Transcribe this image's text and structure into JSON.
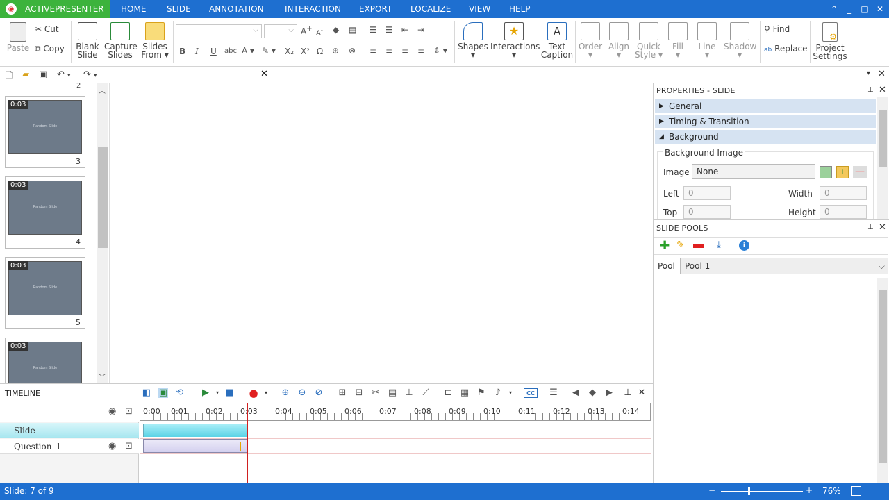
{
  "app": {
    "name": "ACTIVEPRESENTER"
  },
  "menu_tabs": [
    "HOME",
    "SLIDE",
    "ANNOTATION",
    "INTERACTION",
    "EXPORT",
    "LOCALIZE",
    "VIEW",
    "HELP"
  ],
  "ribbon": {
    "paste": "Paste",
    "cut": "Cut",
    "copy": "Copy",
    "blank_slide": [
      "Blank",
      "Slide"
    ],
    "capture_slides": [
      "Capture",
      "Slides"
    ],
    "slides_from": [
      "Slides",
      "From"
    ],
    "shapes": "Shapes",
    "interactions": "Interactions",
    "text_caption": [
      "Text",
      "Caption"
    ],
    "order": "Order",
    "align": "Align",
    "quick_style": [
      "Quick",
      "Style"
    ],
    "fill": "Fill",
    "line": "Line",
    "shadow": "Shadow",
    "find": "Find",
    "replace": "Replace",
    "project_settings": [
      "Project",
      "Settings"
    ]
  },
  "slides": [
    {
      "duration": "0:03",
      "title": "Random Slide",
      "number": "3"
    },
    {
      "duration": "0:03",
      "title": "Random Slide",
      "number": "4"
    },
    {
      "duration": "0:03",
      "title": "Random Slide",
      "number": "5"
    },
    {
      "duration": "0:03",
      "title": "Random Slide",
      "number": ""
    }
  ],
  "properties": {
    "header": "PROPERTIES - SLIDE",
    "sections": [
      "General",
      "Timing & Transition",
      "Background"
    ],
    "bg_group": "Background Image",
    "image_label": "Image",
    "image_value": "None",
    "left_label": "Left",
    "left_value": "0",
    "top_label": "Top",
    "top_value": "0",
    "width_label": "Width",
    "width_value": "0",
    "height_label": "Height",
    "height_value": "0"
  },
  "pools": {
    "header": "SLIDE POOLS",
    "pool_label": "Pool",
    "pool_value": "Pool 1"
  },
  "timeline": {
    "header": "TIMELINE",
    "ticks": [
      "0:00",
      "0:01",
      "0:02",
      "0:03",
      "0:04",
      "0:05",
      "0:06",
      "0:07",
      "0:08",
      "0:09",
      "0:10",
      "0:11",
      "0:12",
      "0:13",
      "0:14"
    ],
    "tracks": [
      "Slide",
      "Question_1"
    ]
  },
  "status": {
    "slide": "Slide: 7 of 9",
    "zoom": "76%"
  }
}
